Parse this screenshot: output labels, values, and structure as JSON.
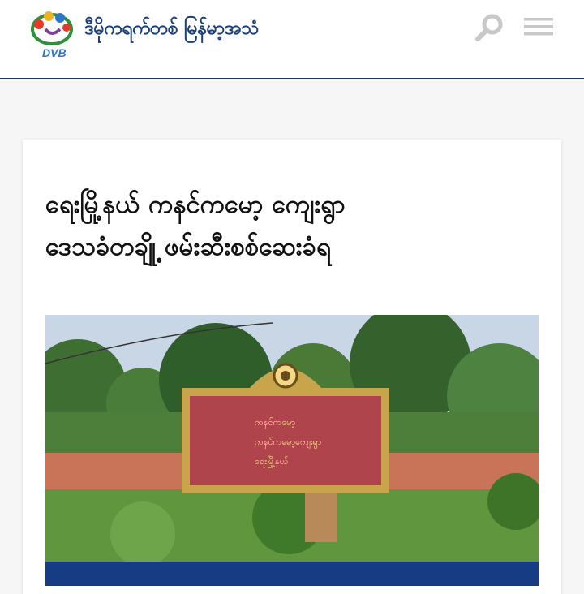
{
  "header": {
    "brand_text": "ဒီမိုကရက်တစ် မြန်မာ့အသံ",
    "logo_text": "DVB",
    "colors": {
      "brand": "#1b3f7a",
      "divider": "#1b3a6b",
      "icon": "#c8c8c8"
    },
    "icons": [
      "search-icon",
      "hamburger-menu-icon"
    ]
  },
  "article": {
    "headline_line1": "ရေးမြို့နယ် ကနင်ကမော့ ကျေးရွာ",
    "headline_line2": "ဒေသခံတချို့ ဖမ်းဆီးစစ်ဆေးခံရ",
    "image_sign_lines": [
      "ကနင်ကမော့",
      "ကနင်ကမော့ကျေးရွာ",
      "ရေးမြို့နယ်"
    ],
    "caption_bar_color": "#163c84"
  }
}
